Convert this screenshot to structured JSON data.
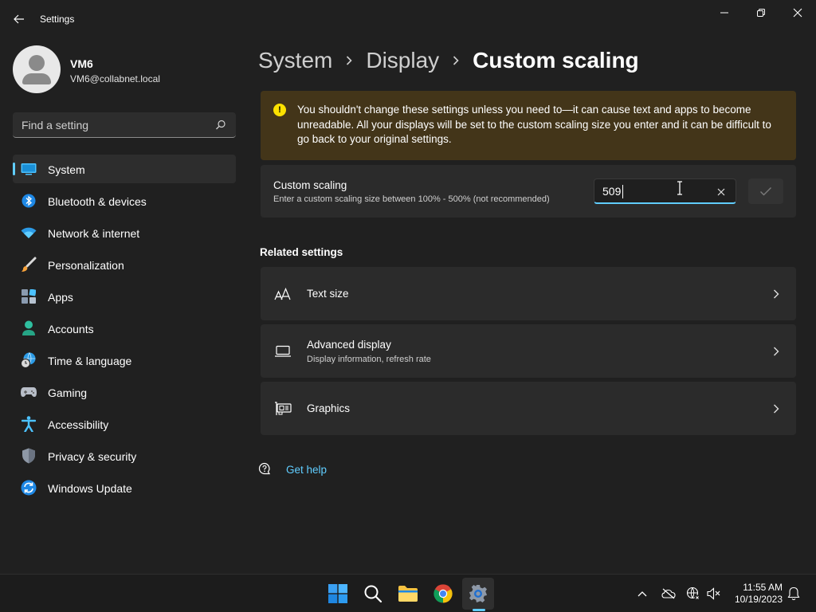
{
  "window": {
    "title": "Settings",
    "controls": {
      "minimize": "minimize-icon",
      "maximize": "restore-icon",
      "close": "close-icon"
    }
  },
  "profile": {
    "name": "VM6",
    "email": "VM6@collabnet.local"
  },
  "search": {
    "placeholder": "Find a setting"
  },
  "sidebar": {
    "items": [
      {
        "label": "System",
        "icon": "system-icon",
        "active": true
      },
      {
        "label": "Bluetooth & devices",
        "icon": "bluetooth-icon"
      },
      {
        "label": "Network & internet",
        "icon": "wifi-icon"
      },
      {
        "label": "Personalization",
        "icon": "brush-icon"
      },
      {
        "label": "Apps",
        "icon": "apps-icon"
      },
      {
        "label": "Accounts",
        "icon": "accounts-icon"
      },
      {
        "label": "Time & language",
        "icon": "globe-clock-icon"
      },
      {
        "label": "Gaming",
        "icon": "gamepad-icon"
      },
      {
        "label": "Accessibility",
        "icon": "accessibility-icon"
      },
      {
        "label": "Privacy & security",
        "icon": "shield-icon"
      },
      {
        "label": "Windows Update",
        "icon": "update-icon"
      }
    ]
  },
  "breadcrumb": {
    "items": [
      "System",
      "Display"
    ],
    "current": "Custom scaling"
  },
  "warning": {
    "text": "You shouldn't change these settings unless you need to—it can cause text and apps to become unreadable. All your displays will be set to the custom scaling size you enter and it can be difficult to go back to your original settings."
  },
  "custom_scaling": {
    "title": "Custom scaling",
    "description": "Enter a custom scaling size between 100% - 500% (not recommended)",
    "value": "509"
  },
  "related": {
    "header": "Related settings",
    "items": [
      {
        "title": "Text size",
        "subtitle": "",
        "icon": "text-size-icon"
      },
      {
        "title": "Advanced display",
        "subtitle": "Display information, refresh rate",
        "icon": "monitor-icon"
      },
      {
        "title": "Graphics",
        "subtitle": "",
        "icon": "graphics-card-icon"
      }
    ]
  },
  "help": {
    "label": "Get help"
  },
  "taskbar": {
    "apps": [
      "start-icon",
      "search-icon",
      "file-explorer-icon",
      "chrome-icon",
      "settings-icon"
    ],
    "tray": [
      "chevron-up-icon",
      "onedrive-offline-icon",
      "network-icon",
      "volume-muted-icon",
      "notifications-icon"
    ],
    "time": "11:55 AM",
    "date": "10/19/2023"
  },
  "colors": {
    "accent": "#60cdff",
    "background": "#202020",
    "card": "#2b2b2b",
    "warning_bg": "#433519",
    "warning_icon": "#fce100"
  }
}
